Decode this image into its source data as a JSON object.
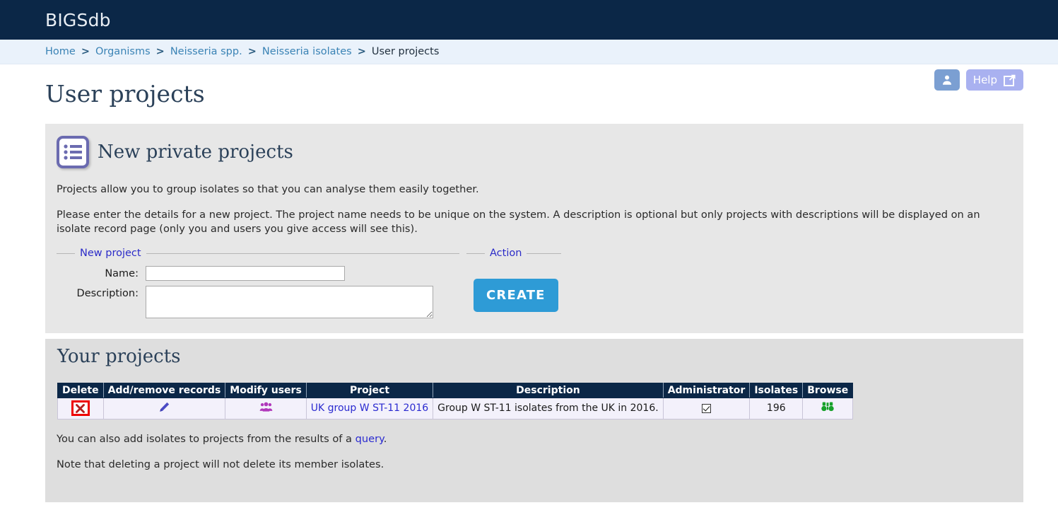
{
  "header": {
    "brand": "BIGSdb"
  },
  "breadcrumb": {
    "items": [
      {
        "label": "Home",
        "link": true
      },
      {
        "label": "Organisms",
        "link": true
      },
      {
        "label": "Neisseria spp.",
        "link": true
      },
      {
        "label": "Neisseria isolates",
        "link": true
      },
      {
        "label": "User projects",
        "link": false
      }
    ],
    "separator": ">"
  },
  "corner": {
    "user_icon": "user-icon",
    "help_label": "Help",
    "help_icon": "external-link-icon"
  },
  "page": {
    "title": "User projects"
  },
  "new_projects": {
    "icon": "list-icon",
    "heading": "New private projects",
    "paragraph1": "Projects allow you to group isolates so that you can analyse them easily together.",
    "paragraph2": "Please enter the details for a new project. The project name needs to be unique on the system. A description is optional but only projects with descriptions will be displayed on an isolate record page (only you and users you give access will see this).",
    "fieldset_project_legend": "New project",
    "fieldset_action_legend": "Action",
    "name_label": "Name:",
    "name_value": "",
    "name_placeholder": "",
    "description_label": "Description:",
    "description_value": "",
    "description_placeholder": "",
    "create_label": "CREATE"
  },
  "your_projects": {
    "heading": "Your projects",
    "columns": [
      "Delete",
      "Add/remove records",
      "Modify users",
      "Project",
      "Description",
      "Administrator",
      "Isolates",
      "Browse"
    ],
    "rows": [
      {
        "delete_icon": "delete-x-icon",
        "edit_icon": "pencil-icon",
        "users_icon": "users-group-icon",
        "project": "UK group W ST-11 2016",
        "description": "Group W ST-11 isolates from the UK in 2016.",
        "administrator": true,
        "isolates": "196",
        "browse_icon": "binoculars-icon"
      }
    ],
    "note1_before": "You can also add isolates to projects from the results of a ",
    "note1_link": "query",
    "note1_after": ".",
    "note2": "Note that deleting a project will not delete its member isolates."
  },
  "colors": {
    "navy": "#0b2747",
    "breadcrumb_bg": "#eaf2fb",
    "link_blue": "#3a83b5",
    "create_blue": "#2e9bd6",
    "help_purple": "#a9b1f0",
    "user_blue": "#7b9fd2",
    "delete_red": "#ef0000",
    "browse_green": "#17a12a",
    "users_magenta": "#b038bb",
    "pencil_blue": "#4b4bc4",
    "panel_top_bg": "#e7e7e7",
    "panel_bottom_bg": "#dedede"
  }
}
